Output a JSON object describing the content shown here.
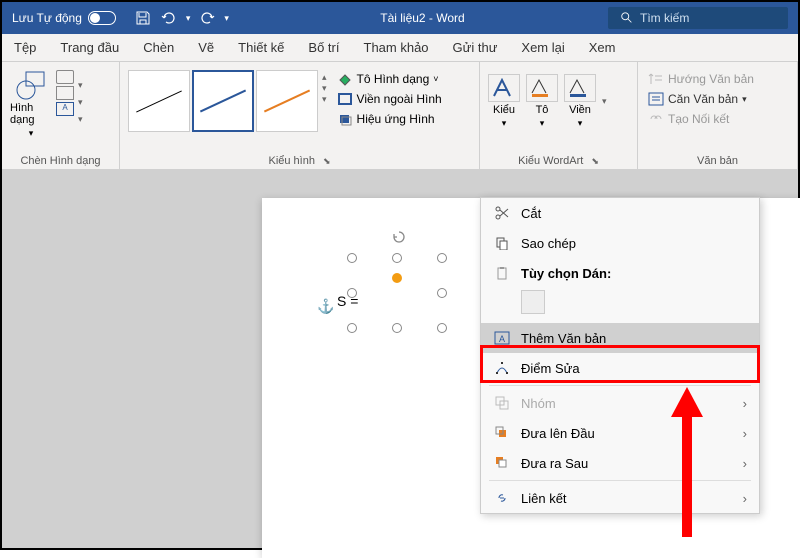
{
  "titlebar": {
    "autosave": "Lưu Tự động",
    "doc_title": "Tài liệu2 - Word",
    "search_placeholder": "Tìm kiếm"
  },
  "tabs": [
    "Tệp",
    "Trang đầu",
    "Chèn",
    "Vẽ",
    "Thiết kế",
    "Bố trí",
    "Tham khảo",
    "Gửi thư",
    "Xem lại",
    "Xem"
  ],
  "ribbon": {
    "shapes": {
      "label": "Chèn Hình dạng",
      "button": "Hình dạng"
    },
    "styles": {
      "label": "Kiểu hình"
    },
    "fill": {
      "fill": "Tô Hình dạng",
      "outline": "Viền ngoài Hình",
      "effects": "Hiệu ứng Hình"
    },
    "wordart": {
      "label": "Kiểu WordArt",
      "style": "Kiểu",
      "fill": "Tô",
      "outline": "Viền"
    },
    "text": {
      "label": "Văn bản",
      "direction": "Hướng Văn bản",
      "align": "Căn Văn bản",
      "link": "Tạo Nối kết"
    }
  },
  "canvas": {
    "s_equals": "S ="
  },
  "context_menu": {
    "cut": "Cắt",
    "copy": "Sao chép",
    "paste_title": "Tùy chọn Dán:",
    "add_text": "Thêm Văn bản",
    "edit_points": "Điểm Sửa",
    "group": "Nhóm",
    "bring_front": "Đưa lên Đầu",
    "send_back": "Đưa ra Sau",
    "link": "Liên kết"
  }
}
